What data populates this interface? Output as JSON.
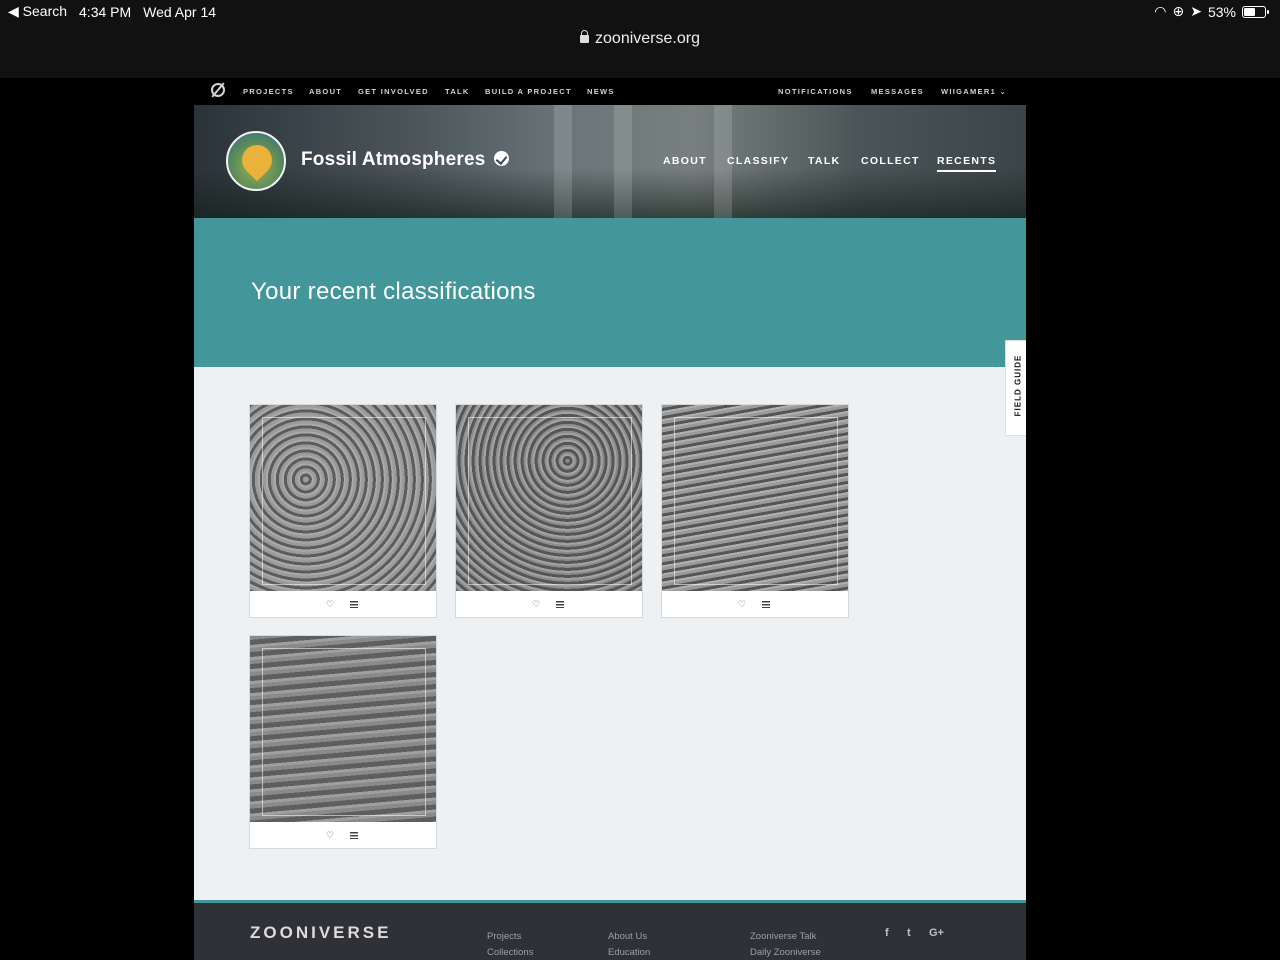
{
  "status_bar": {
    "back_label": "◀ Search",
    "time": "4:34 PM",
    "date": "Wed Apr 14",
    "battery": "53%",
    "battery_level": 0.53
  },
  "browser": {
    "url": "zooniverse.org"
  },
  "zoo_nav": {
    "items": [
      "PROJECTS",
      "ABOUT",
      "GET INVOLVED",
      "TALK",
      "BUILD A PROJECT",
      "NEWS"
    ],
    "right_items": [
      "NOTIFICATIONS",
      "MESSAGES"
    ],
    "user": "WIIGAMER1"
  },
  "project": {
    "title": "Fossil Atmospheres",
    "nav": [
      "ABOUT",
      "CLASSIFY",
      "TALK",
      "COLLECT",
      "RECENTS"
    ],
    "active_nav": "RECENTS"
  },
  "banner": {
    "heading": "Your recent classifications"
  },
  "field_guide": {
    "label": "FIELD GUIDE"
  },
  "recents": [
    {
      "fav_icon": "heart-icon",
      "collect_icon": "list-icon"
    },
    {
      "fav_icon": "heart-icon",
      "collect_icon": "list-icon"
    },
    {
      "fav_icon": "heart-icon",
      "collect_icon": "list-icon"
    },
    {
      "fav_icon": "heart-icon",
      "collect_icon": "list-icon"
    }
  ],
  "footer": {
    "brand": "ZOONIVERSE",
    "col1": [
      "Projects",
      "Collections"
    ],
    "col2": [
      "About Us",
      "Education"
    ],
    "col3": [
      "Zooniverse Talk",
      "Daily Zooniverse"
    ],
    "social": [
      "f",
      "t",
      "G+"
    ]
  },
  "colors": {
    "teal": "#43979b",
    "footer": "#2f3136"
  }
}
